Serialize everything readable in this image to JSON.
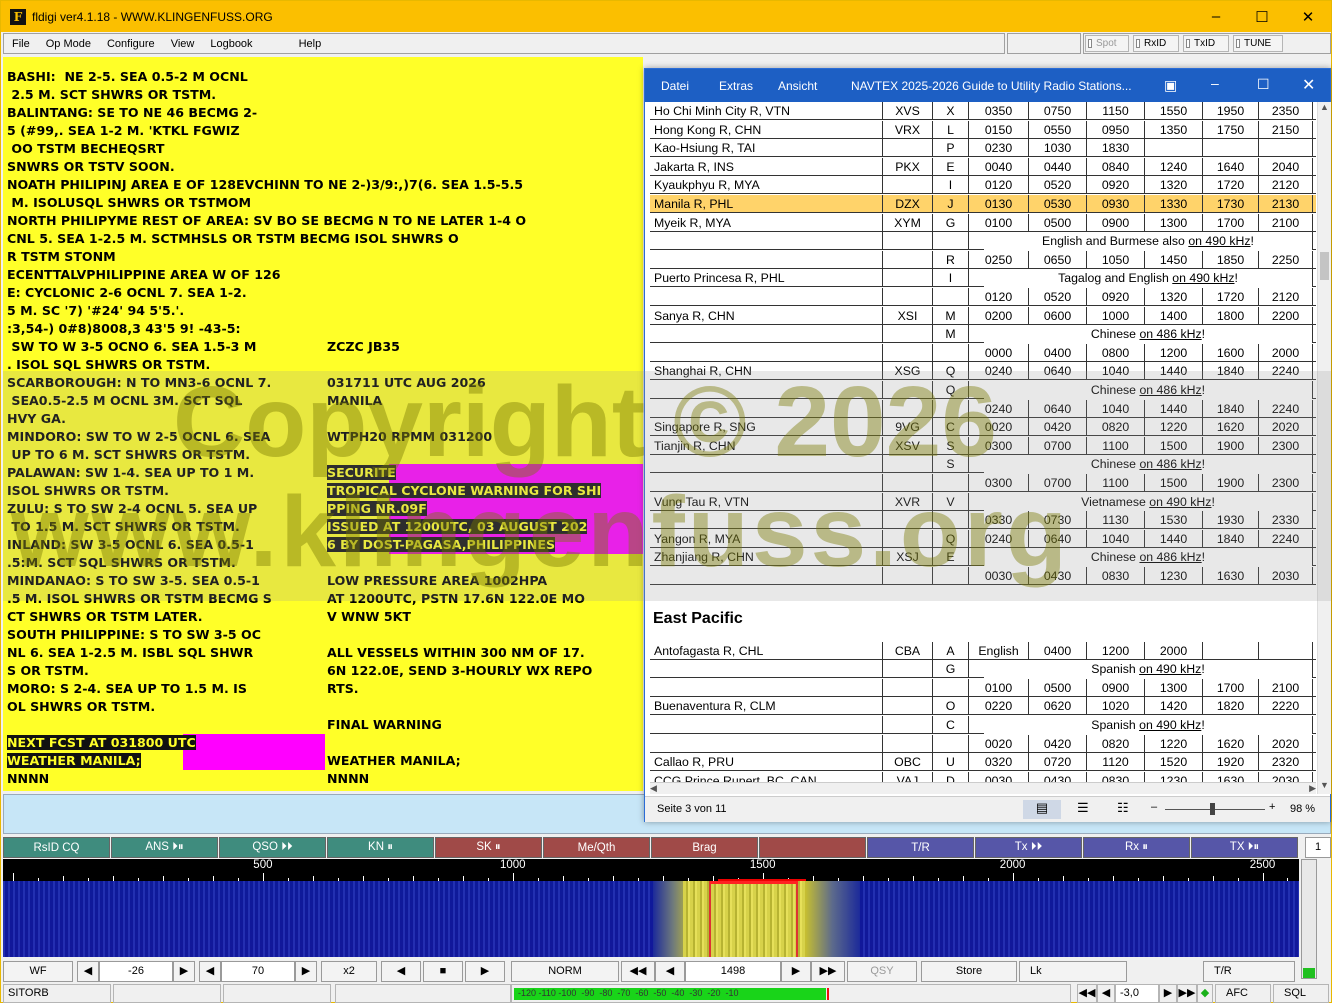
{
  "window": {
    "title": "fldigi ver4.1.18 - WWW.KLINGENFUSS.ORG"
  },
  "menu": {
    "file": "File",
    "op_mode": "Op Mode",
    "configure": "Configure",
    "view": "View",
    "logbook": "Logbook",
    "help": "Help"
  },
  "toolbar": {
    "spot": "Spot",
    "rxid": "RxID",
    "txid": "TxID",
    "tune": "TUNE"
  },
  "rx_left": [
    "BASHI:  NE 2-5. SEA 0.5-2 M OCNL",
    " 2.5 M. SCT SHWRS OR TSTM.",
    "BALINTANG: SE TO NE 46 BECMG 2-",
    "5 (#99,. SEA 1-2 M. 'KTKL FGWIZ",
    " OO TSTM BECHEQSRT",
    "SNWRS OR TSTV SOON.",
    "NOATH PHILIPINJ AREA E OF 128EVCHINN TO NE 2-)3/9:,)7(6. SEA 1.5-5.5",
    " M. ISOLUSQL SHWRS OR TSTMOM",
    "NORTH PHILIPYME REST OF AREA: SV BO SE BECMG N TO NE LATER 1-4 O",
    "CNL 5. SEA 1-2.5 M. SCTMHSLS OR TSTM BECMG ISOL SHWRS O",
    "R TSTM STONM",
    "ECENTTALVPHILIPPINE AREA W OF 126",
    "E: CYCLONIC 2-6 OCNL 7. SEA 1-2.",
    "5 M. SC '7) '#24' 94 5'5.'.",
    ":3,54-) 0#8)8008,3 43'5 9! -43-5:",
    " SW TO W 3-5 OCNO 6. SEA 1.5-3 M",
    ". ISOL SQL SHWRS OR TSTM.",
    "SCARBOROUGH: N TO MN3-6 OCNL 7.",
    " SEA0.5-2.5 M OCNL 3M. SCT SQL",
    "HVY GA.",
    "MINDORO: SW TO W 2-5 OCNL 6. SEA",
    " UP TO 6 M. SCT SHWRS OR TSTM.",
    "PALAWAN: SW 1-4. SEA UP TO 1 M.",
    "ISOL SHWRS OR TSTM.",
    "ZULU: S TO SW 2-4 OCNL 5. SEA UP",
    " TO 1.5 M. SCT SHWRS OR TSTM.",
    "INLAND: SW 3-5 OCNL 6. SEA 0.5-1",
    ".5:M. SCT SQL SHWRS OR TSTM.",
    "MINDANAO: S TO SW 3-5. SEA 0.5-1",
    ".5 M. ISOL SHWRS OR TSTM BECMG S",
    "CT SHWRS OR TSTM LATER.",
    "SOUTH PHILIPPINE: S TO SW 3-5 OC",
    "NL 6. SEA 1-2.5 M. ISBL SQL SHWR",
    "S OR TSTM.",
    "MORO: S 2-4. SEA UP TO 1.5 M. IS",
    "OL SHWRS OR TSTM.",
    "",
    "NEXT FCST AT 031800 UTC",
    "WEATHER MANILA;",
    "NNNN"
  ],
  "rx_right": [
    "ZCZC JB35",
    "",
    "031711 UTC AUG 2026",
    "MANILA",
    "",
    "WTPH20 RPMM 031200",
    "",
    "SECURITE",
    "TROPICAL CYCLONE WARNING FOR SHI",
    "PPING NR.09F",
    "ISSUED AT 1200UTC, 03 AUGUST 202",
    "6 BY DOST-PAGASA,PHILIPPINES",
    "",
    "LOW PRESSURE AREA 1002HPA",
    "AT 1200UTC, PSTN 17.6N 122.0E MO",
    "V WNW 5KT",
    "",
    "ALL VESSELS WITHIN 300 NM OF 17.",
    "6N 122.0E, SEND 3-HOURLY WX REPO",
    "RTS.",
    "",
    "FINAL WARNING",
    "",
    "WEATHER MANILA;",
    "NNNN"
  ],
  "doc": {
    "menu": [
      "Datei",
      "Extras",
      "Ansicht"
    ],
    "title": "NAVTEX 2025-2026 Guide to Utility Radio Stations...",
    "rows": [
      [
        "Ho Chi Minh City R, VTN",
        "XVS",
        "X",
        "0350",
        "0750",
        "1150",
        "1550",
        "1950",
        "2350"
      ],
      [
        "Hong Kong R, CHN",
        "VRX",
        "L",
        "0150",
        "0550",
        "0950",
        "1350",
        "1750",
        "2150"
      ],
      [
        "Kao-Hsiung R, TAI",
        "",
        "P",
        "0230",
        "1030",
        "1830",
        "",
        "",
        ""
      ],
      [
        "Jakarta R, INS",
        "PKX",
        "E",
        "0040",
        "0440",
        "0840",
        "1240",
        "1640",
        "2040"
      ],
      [
        "Kyaukphyu R, MYA",
        "",
        "I",
        "0120",
        "0520",
        "0920",
        "1320",
        "1720",
        "2120"
      ],
      [
        "Manila R, PHL",
        "DZX",
        "J",
        "0130",
        "0530",
        "0930",
        "1330",
        "1730",
        "2130"
      ],
      [
        "Myeik R, MYA",
        "XYM",
        "G",
        "0100",
        "0500",
        "0900",
        "1300",
        "1700",
        "2100"
      ],
      [
        "",
        "",
        "",
        "English and Burmese also on 490 kHz!"
      ],
      [
        "",
        "",
        "R",
        "0250",
        "0650",
        "1050",
        "1450",
        "1850",
        "2250"
      ],
      [
        "Puerto Princesa R, PHL",
        "",
        "I",
        "Tagalog and English on 490 kHz!"
      ],
      [
        "",
        "",
        "",
        "0120",
        "0520",
        "0920",
        "1320",
        "1720",
        "2120"
      ],
      [
        "Sanya R, CHN",
        "XSI",
        "M",
        "0200",
        "0600",
        "1000",
        "1400",
        "1800",
        "2200"
      ],
      [
        "",
        "",
        "M",
        "Chinese on 486 kHz!"
      ],
      [
        "",
        "",
        "",
        "0000",
        "0400",
        "0800",
        "1200",
        "1600",
        "2000"
      ],
      [
        "Shanghai R, CHN",
        "XSG",
        "Q",
        "0240",
        "0640",
        "1040",
        "1440",
        "1840",
        "2240"
      ],
      [
        "",
        "",
        "Q",
        "Chinese on 486 kHz!"
      ],
      [
        "",
        "",
        "",
        "0240",
        "0640",
        "1040",
        "1440",
        "1840",
        "2240"
      ],
      [
        "Singapore R, SNG",
        "9VG",
        "C",
        "0020",
        "0420",
        "0820",
        "1220",
        "1620",
        "2020"
      ],
      [
        "Tianjin R, CHN",
        "XSV",
        "S",
        "0300",
        "0700",
        "1100",
        "1500",
        "1900",
        "2300"
      ],
      [
        "",
        "",
        "S",
        "Chinese on 486 kHz!"
      ],
      [
        "",
        "",
        "",
        "0300",
        "0700",
        "1100",
        "1500",
        "1900",
        "2300"
      ],
      [
        "Vung Tau R, VTN",
        "XVR",
        "V",
        "Vietnamese on 490 kHz!"
      ],
      [
        "",
        "",
        "",
        "0330",
        "0730",
        "1130",
        "1530",
        "1930",
        "2330"
      ],
      [
        "Yangon R, MYA",
        "",
        "Q",
        "0240",
        "0640",
        "1040",
        "1440",
        "1840",
        "2240"
      ],
      [
        "Zhanjiang R, CHN",
        "XSJ",
        "E",
        "Chinese on 486 kHz!"
      ],
      [
        "",
        "",
        "",
        "0030",
        "0430",
        "0830",
        "1230",
        "1630",
        "2030"
      ]
    ],
    "section": "East Pacific",
    "rows2": [
      [
        "Antofagasta R, CHL",
        "CBA",
        "A",
        "English",
        "0400",
        "1200",
        "2000",
        "",
        ""
      ],
      [
        "",
        "",
        "G",
        "Spanish on 490 kHz!"
      ],
      [
        "",
        "",
        "",
        "0100",
        "0500",
        "0900",
        "1300",
        "1700",
        "2100"
      ],
      [
        "Buenaventura R, CLM",
        "",
        "O",
        "0220",
        "0620",
        "1020",
        "1420",
        "1820",
        "2220"
      ],
      [
        "",
        "",
        "C",
        "Spanish on 490 kHz!"
      ],
      [
        "",
        "",
        "",
        "0020",
        "0420",
        "0820",
        "1220",
        "1620",
        "2020"
      ],
      [
        "Callao R, PRU",
        "OBC",
        "U",
        "0320",
        "0720",
        "1120",
        "1520",
        "1920",
        "2320"
      ],
      [
        "CCG Prince Rupert, BC, CAN",
        "VAJ",
        "D",
        "0030",
        "0430",
        "0830",
        "1230",
        "1630",
        "2030"
      ]
    ],
    "page": "Seite 3 von 11",
    "zoom": "98 %"
  },
  "watermark": [
    "Copyright © 2026",
    "www.klingenfuss.org"
  ],
  "macros": [
    {
      "label": "RsID CQ",
      "color": "#3f8c7e"
    },
    {
      "label": "ANS ⏵⏸",
      "color": "#3f8c7e"
    },
    {
      "label": "QSO ⏵⏵",
      "color": "#3f8c7e"
    },
    {
      "label": "KN ⏸",
      "color": "#3f8c7e"
    },
    {
      "label": "SK ⏸",
      "color": "#a04a48"
    },
    {
      "label": "Me/Qth",
      "color": "#a04a48"
    },
    {
      "label": "Brag",
      "color": "#a04a48"
    },
    {
      "label": "",
      "color": "#a04a48"
    },
    {
      "label": "T/R",
      "color": "#5656a8"
    },
    {
      "label": "Tx ⏵⏵",
      "color": "#5656a8"
    },
    {
      "label": "Rx ⏸",
      "color": "#5656a8"
    },
    {
      "label": "TX ⏵⏸",
      "color": "#5656a8"
    }
  ],
  "macro_set": "1",
  "scale": [
    "500",
    "1000",
    "1500",
    "2000",
    "2500"
  ],
  "controls": {
    "wf": "WF",
    "ref": "-26",
    "range": "70",
    "x2": "x2",
    "norm": "NORM",
    "freq": "1498",
    "qsy": "QSY",
    "store": "Store",
    "lk": "Lk",
    "tr": "T/R"
  },
  "status": {
    "mode": "SITORB",
    "meter": "-120 -110 -100  -90  -80  -70  -60  -50  -40  -30  -20  -10",
    "offset": "-3,0",
    "afc": "AFC",
    "sql": "SQL"
  }
}
